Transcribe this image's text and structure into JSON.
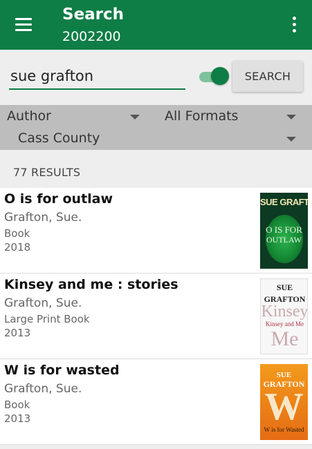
{
  "app_bar": {
    "title": "Search",
    "subtitle": "2002200"
  },
  "search": {
    "query": "sue grafton",
    "toggle_on": true,
    "button_label": "SEARCH"
  },
  "filters": {
    "search_by": "Author",
    "format": "All Formats",
    "location": "Cass County"
  },
  "results_count": "77 RESULTS",
  "results": [
    {
      "title": "O is for outlaw",
      "author": "Grafton, Sue.",
      "format": "Book",
      "year": "2018",
      "cover_text": [
        "SUE GRAFTON",
        "O IS FOR",
        "OUTLAW"
      ]
    },
    {
      "title": "Kinsey and me : stories",
      "author": "Grafton, Sue.",
      "format": "Large Print Book",
      "year": "2013",
      "cover_text": [
        "SUE",
        "GRAFTON",
        "Kinsey",
        "Kinsey and Me",
        "Me"
      ]
    },
    {
      "title": "W is for wasted",
      "author": "Grafton, Sue.",
      "format": "Book",
      "year": "2013",
      "cover_text": [
        "SUE",
        "GRAFTON",
        "W",
        "W is for Wasted"
      ]
    }
  ],
  "colors": {
    "primary": "#0f7d46",
    "filter_bar": "#bdbdbd",
    "background": "#eeeeee"
  },
  "icons": {
    "menu": "hamburger-menu-icon",
    "overflow": "more-vert-icon",
    "dropdown": "dropdown-caret-icon"
  }
}
